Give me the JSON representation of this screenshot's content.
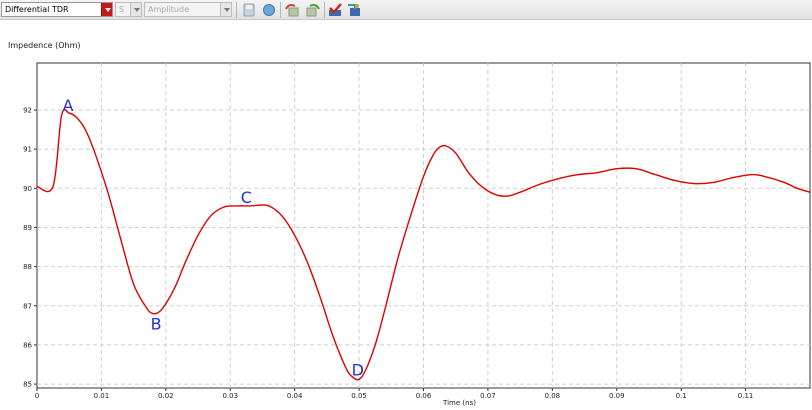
{
  "toolbar": {
    "mode_select": "Differential TDR",
    "param_select": "S",
    "format_select": "Amplitude",
    "icons": [
      "save-icon",
      "record-icon",
      "undo-icon",
      "redo-icon",
      "check-icon",
      "export-icon"
    ]
  },
  "chart_data": {
    "type": "line",
    "title": "",
    "ylabel": "Impedence (Ohm)",
    "xlabel": "Time (ns)",
    "xlim": [
      0,
      0.12
    ],
    "ylim": [
      84.9,
      93.2
    ],
    "xticks": [
      "0",
      "0.01",
      "0.02",
      "0.03",
      "0.04",
      "0.05",
      "0.06",
      "0.07",
      "0.08",
      "0.09",
      "0.1",
      "0.11"
    ],
    "yticks": [
      "85",
      "86",
      "87",
      "88",
      "89",
      "90",
      "91",
      "92"
    ],
    "grid": true,
    "series": [
      {
        "color": "#e00000",
        "x": [
          0,
          0.0025,
          0.0038,
          0.005,
          0.0062,
          0.0075,
          0.009,
          0.011,
          0.013,
          0.015,
          0.017,
          0.018,
          0.019,
          0.02,
          0.0215,
          0.023,
          0.025,
          0.027,
          0.029,
          0.031,
          0.033,
          0.0345,
          0.036,
          0.038,
          0.04,
          0.042,
          0.044,
          0.046,
          0.048,
          0.049,
          0.05,
          0.051,
          0.0525,
          0.054,
          0.056,
          0.058,
          0.06,
          0.0615,
          0.0625,
          0.0635,
          0.065,
          0.067,
          0.069,
          0.071,
          0.073,
          0.075,
          0.078,
          0.081,
          0.084,
          0.087,
          0.09,
          0.093,
          0.096,
          0.099,
          0.102,
          0.105,
          0.108,
          0.111,
          0.113,
          0.116,
          0.118,
          0.12
        ],
        "y": [
          90.05,
          90.05,
          91.85,
          91.92,
          91.8,
          91.5,
          90.9,
          89.9,
          88.7,
          87.55,
          86.95,
          86.8,
          86.85,
          87.05,
          87.5,
          88.1,
          88.8,
          89.3,
          89.52,
          89.55,
          89.55,
          89.57,
          89.55,
          89.3,
          88.8,
          88.1,
          87.2,
          86.2,
          85.4,
          85.18,
          85.12,
          85.35,
          86.0,
          86.9,
          88.2,
          89.3,
          90.3,
          90.85,
          91.05,
          91.08,
          90.9,
          90.4,
          90.05,
          89.85,
          89.8,
          89.9,
          90.1,
          90.25,
          90.35,
          90.4,
          90.5,
          90.5,
          90.35,
          90.2,
          90.12,
          90.15,
          90.27,
          90.35,
          90.3,
          90.15,
          90.0,
          89.9
        ]
      }
    ],
    "annotations": [
      {
        "label": "A",
        "x": 0.0048,
        "y": 92.13
      },
      {
        "label": "B",
        "x": 0.0185,
        "y": 86.55
      },
      {
        "label": "C",
        "x": 0.0325,
        "y": 89.78
      },
      {
        "label": "D",
        "x": 0.0498,
        "y": 85.37
      }
    ]
  }
}
